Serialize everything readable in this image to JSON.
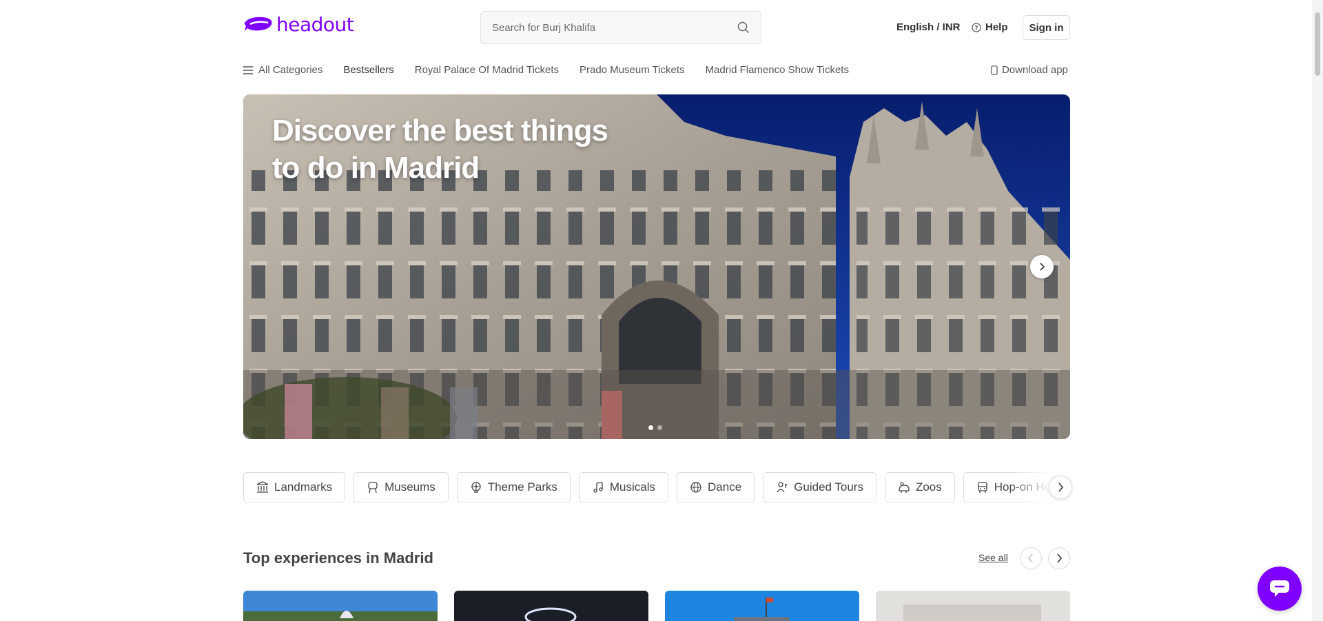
{
  "header": {
    "logo_text": "headout",
    "search_placeholder": "Search for Burj Khalifa",
    "language_currency": "English / INR",
    "help_label": "Help",
    "signin_label": "Sign in"
  },
  "nav": {
    "all_categories": "All Categories",
    "items": [
      "Bestsellers",
      "Royal Palace Of Madrid Tickets",
      "Prado Museum Tickets",
      "Madrid Flamenco Show Tickets"
    ],
    "download_app": "Download app"
  },
  "hero": {
    "title": "Discover the best things to do in Madrid",
    "slide_count": 2,
    "active_slide": 1
  },
  "categories": [
    {
      "label": "Landmarks",
      "icon": "landmark-icon"
    },
    {
      "label": "Museums",
      "icon": "museum-icon"
    },
    {
      "label": "Theme Parks",
      "icon": "theme-park-icon"
    },
    {
      "label": "Musicals",
      "icon": "music-note-icon"
    },
    {
      "label": "Dance",
      "icon": "globe-icon"
    },
    {
      "label": "Guided Tours",
      "icon": "guide-icon"
    },
    {
      "label": "Zoos",
      "icon": "zoo-icon"
    },
    {
      "label": "Hop-on Hop-off",
      "icon": "bus-icon"
    }
  ],
  "top_experiences": {
    "title": "Top experiences in Madrid",
    "see_all": "See all"
  },
  "colors": {
    "brand": "#8000ff",
    "sky": "#0a2a8c",
    "text": "#444444"
  }
}
